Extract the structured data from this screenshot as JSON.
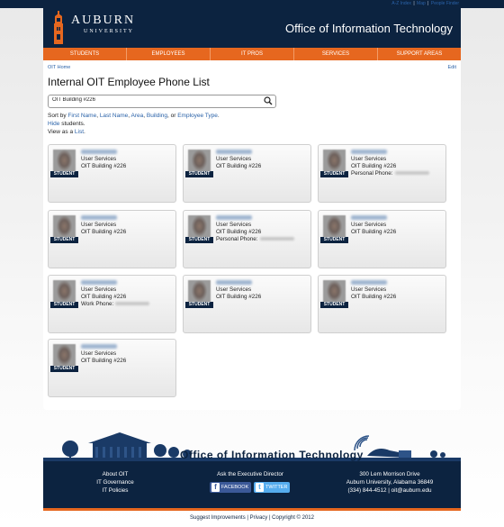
{
  "top_links": [
    "A-Z Index",
    "Map",
    "People Finder"
  ],
  "header": {
    "logo_title": "AUBURN",
    "logo_subtitle": "UNIVERSITY",
    "office_title": "Office of Information Technology"
  },
  "nav": [
    "STUDENTS",
    "EMPLOYEES",
    "IT PROS",
    "SERVICES",
    "SUPPORT AREAS"
  ],
  "breadcrumb": "OIT Home",
  "edit_label": "Edit",
  "page_title": "Internal OIT Employee Phone List",
  "search": {
    "value": "OIT Building #226"
  },
  "sort": {
    "prefix": "Sort by",
    "options": [
      "First Name",
      "Last Name",
      "Area",
      "Building",
      "Employee Type"
    ]
  },
  "hide": {
    "link": "Hide",
    "text": "students."
  },
  "view": {
    "prefix": "View as a",
    "link": "List"
  },
  "student_badge": "STUDENT",
  "cards": [
    {
      "dept": "User Services",
      "building": "OIT Building #226",
      "phone_label": ""
    },
    {
      "dept": "User Services",
      "building": "OIT Building #226",
      "phone_label": ""
    },
    {
      "dept": "User Services",
      "building": "OIT Building #226",
      "phone_label": "Personal Phone:"
    },
    {
      "dept": "User Services",
      "building": "OIT Building #226",
      "phone_label": ""
    },
    {
      "dept": "User Services",
      "building": "OIT Building #226",
      "phone_label": "Personal Phone:"
    },
    {
      "dept": "User Services",
      "building": "OIT Building #226",
      "phone_label": ""
    },
    {
      "dept": "User Services",
      "building": "OIT Building #226",
      "phone_label": "Work Phone:"
    },
    {
      "dept": "User Services",
      "building": "OIT Building #226",
      "phone_label": ""
    },
    {
      "dept": "User Services",
      "building": "OIT Building #226",
      "phone_label": ""
    },
    {
      "dept": "User Services",
      "building": "OIT Building #226",
      "phone_label": ""
    }
  ],
  "footer": {
    "title": "Office of Information Technology",
    "links": [
      "About OIT",
      "IT Governance",
      "IT Policies"
    ],
    "ask": "Ask the Executive Director",
    "facebook": "FACEBOOK",
    "twitter": "TWITTER",
    "address1": "300 Lem Morrison Drive",
    "address2": "Auburn University, Alabama 36849",
    "contact": "(334) 844-4512 | oit@auburn.edu"
  },
  "bottom_links": "Suggest Improvements | Privacy | Copyright © 2012",
  "colors": {
    "navy": "#0c2340",
    "orange": "#e6671f"
  }
}
